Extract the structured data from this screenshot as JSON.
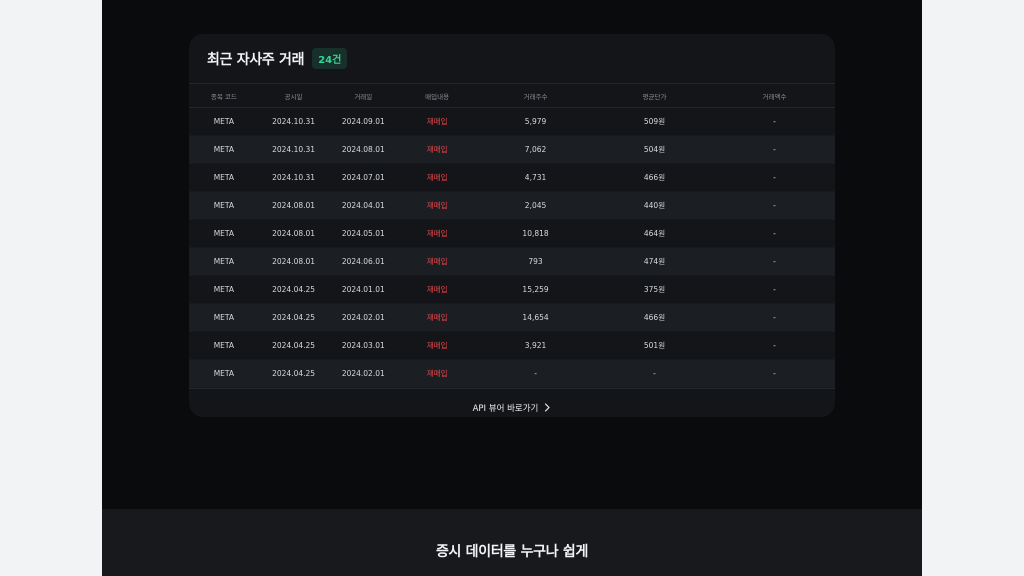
{
  "section": {
    "title": "최근 자사주 거래",
    "count_badge": "24건"
  },
  "table": {
    "headers": [
      "종목 코드",
      "공시일",
      "거래일",
      "매입내용",
      "거래주수",
      "평균단가",
      "거래액수"
    ],
    "rows": [
      [
        "META",
        "2024.10.31",
        "2024.09.01",
        "재매입",
        "5,979",
        "509원",
        "-"
      ],
      [
        "META",
        "2024.10.31",
        "2024.08.01",
        "재매입",
        "7,062",
        "504원",
        "-"
      ],
      [
        "META",
        "2024.10.31",
        "2024.07.01",
        "재매입",
        "4,731",
        "466원",
        "-"
      ],
      [
        "META",
        "2024.08.01",
        "2024.04.01",
        "재매입",
        "2,045",
        "440원",
        "-"
      ],
      [
        "META",
        "2024.08.01",
        "2024.05.01",
        "재매입",
        "10,818",
        "464원",
        "-"
      ],
      [
        "META",
        "2024.08.01",
        "2024.06.01",
        "재매입",
        "793",
        "474원",
        "-"
      ],
      [
        "META",
        "2024.04.25",
        "2024.01.01",
        "재매입",
        "15,259",
        "375원",
        "-"
      ],
      [
        "META",
        "2024.04.25",
        "2024.02.01",
        "재매입",
        "14,654",
        "466원",
        "-"
      ],
      [
        "META",
        "2024.04.25",
        "2024.03.01",
        "재매입",
        "3,921",
        "501원",
        "-"
      ],
      [
        "META",
        "2024.04.25",
        "2024.02.01",
        "재매입",
        "-",
        "-",
        "-"
      ]
    ]
  },
  "footer_link": {
    "label": "API 뷰어 바로가기",
    "icon": "chevron-right-icon"
  },
  "bottom_section": {
    "title": "증시 데이터를 누구나 쉽게"
  },
  "colors": {
    "background": "#0a0b0d",
    "card": "#131518",
    "accent_green": "#34d399",
    "buyback_red": "#e5484d"
  }
}
